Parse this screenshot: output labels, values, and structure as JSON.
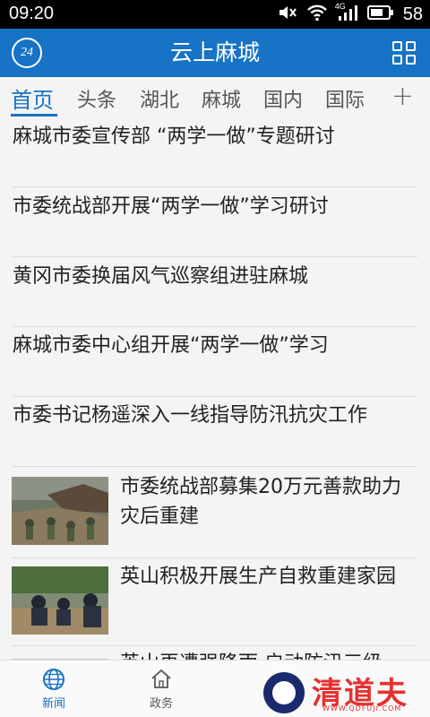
{
  "status_bar": {
    "time": "09:20",
    "network": "4G",
    "battery": "58"
  },
  "header": {
    "logo": "24",
    "title": "云上麻城"
  },
  "tabs": [
    "首页",
    "头条",
    "湖北",
    "麻城",
    "国内",
    "国际"
  ],
  "tabs_add": "+",
  "news_text": [
    "麻城市委宣传部 “两学一做”专题研讨",
    "市委统战部开展“两学一做”学习研讨",
    "黄冈市委换届风气巡察组进驻麻城",
    "麻城市委中心组开展“两学一做”学习",
    "市委书记杨遥深入一线指导防汛抗灾工作"
  ],
  "news_image": [
    "市委统战部募集20万元善款助力灾后重建",
    "英山积极开展生产自救重建家园",
    "英山再遭强降雨 启动防汛三级"
  ],
  "bottom_nav": [
    "新闻",
    "政务"
  ],
  "watermark": {
    "text": "清道夫",
    "url": "WWW.QDFUJI.COM"
  },
  "colors": {
    "accent": "#1673c6",
    "watermark": "#e83030"
  }
}
